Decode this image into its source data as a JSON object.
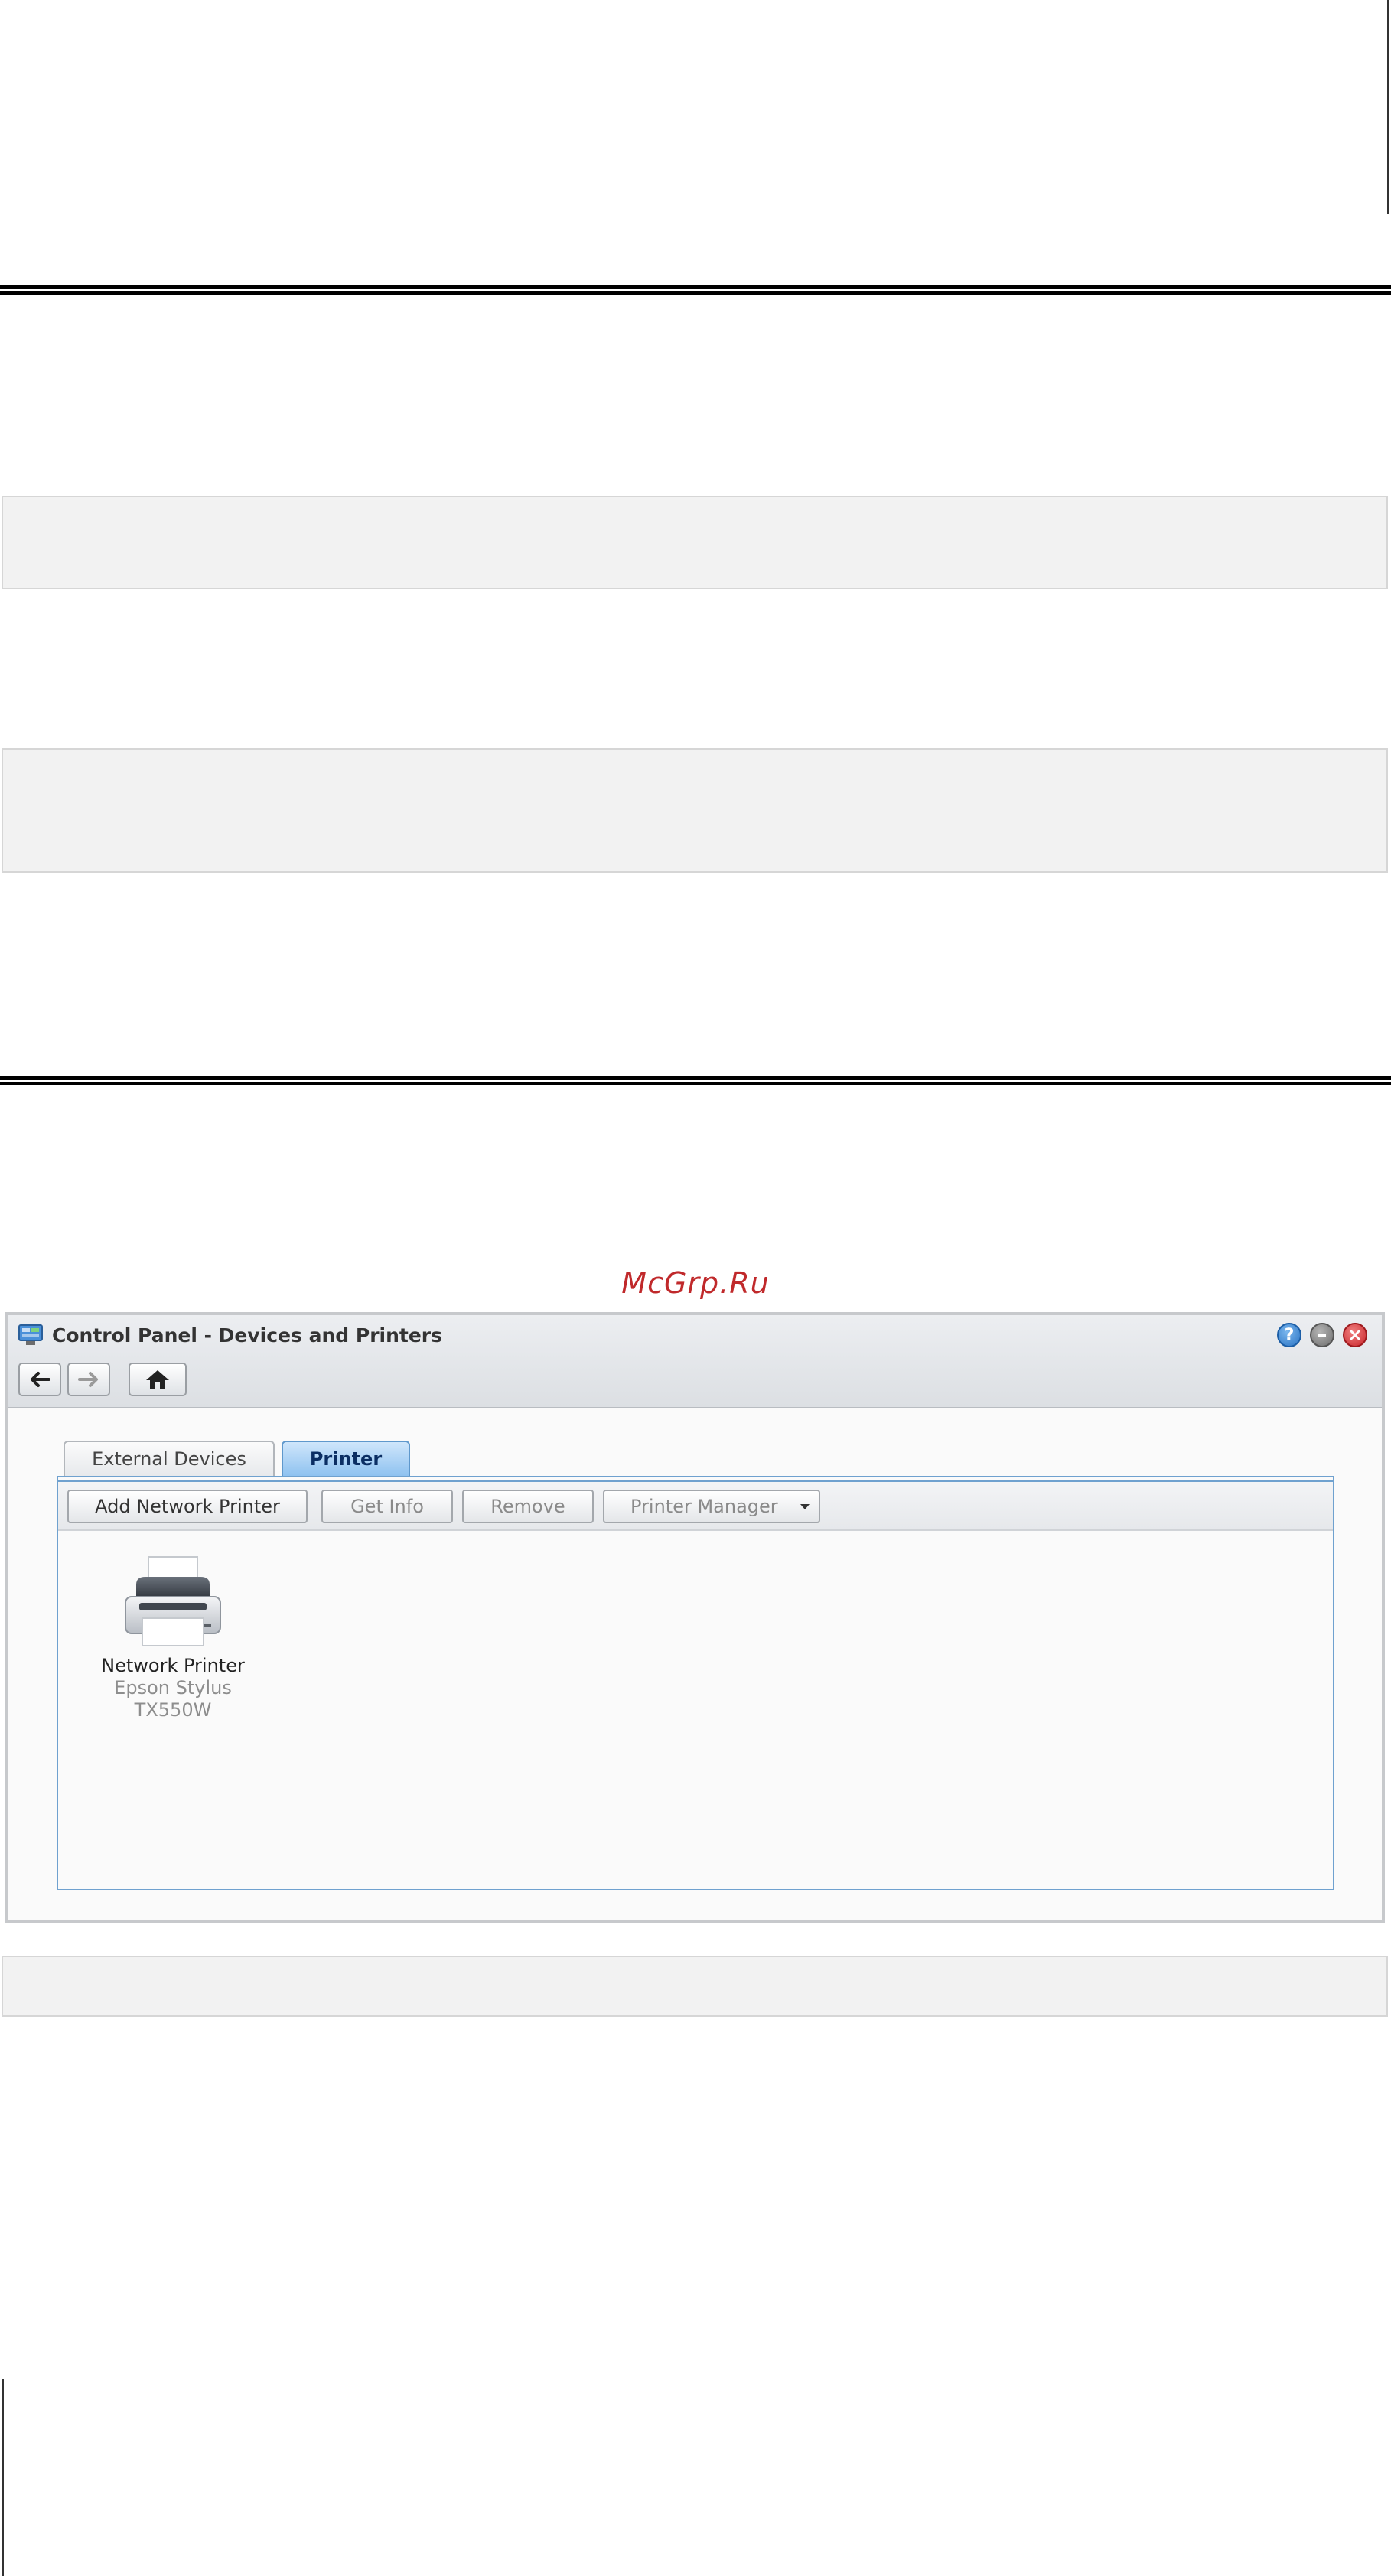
{
  "watermark": "McGrp.Ru",
  "window": {
    "title": "Control Panel - Devices and Printers",
    "help_symbol": "?",
    "tabs": [
      {
        "label": "External Devices"
      },
      {
        "label": "Printer"
      }
    ],
    "toolbar": {
      "add_network_printer": "Add Network Printer",
      "get_info": "Get Info",
      "remove": "Remove",
      "printer_manager": "Printer Manager"
    },
    "printers": [
      {
        "name": "Network Printer",
        "model_line1": "Epson Stylus",
        "model_line2": "TX550W"
      }
    ]
  },
  "colors": {
    "active_tab": "#8fc2f0",
    "panel_border": "#6fa1cf",
    "watermark": "#c0292b",
    "close_button": "#c9252a",
    "help_button": "#2b74c4"
  }
}
